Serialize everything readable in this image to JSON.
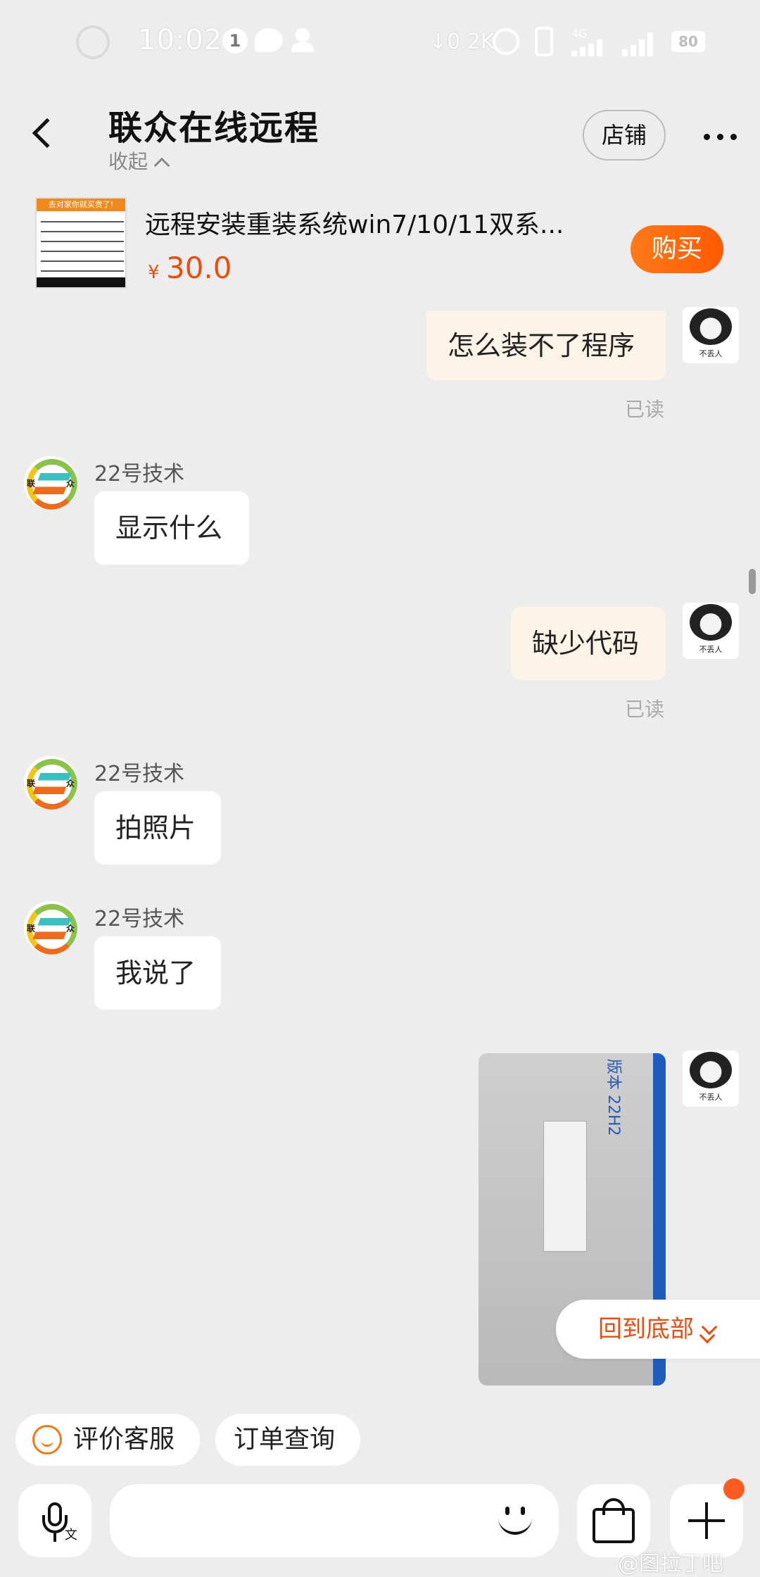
{
  "status_bar": {
    "time": "10:02",
    "notif_count": "1",
    "net_speed": "↓0.2K",
    "network": "4G",
    "battery": "80"
  },
  "header": {
    "title": "联众在线远程",
    "collapse_label": "收起",
    "store_label": "店铺"
  },
  "product": {
    "thumb_banner": "去对家你就买贵了!",
    "name": "远程安装重装系统win7/10/11双系...",
    "currency": "¥",
    "price": "30.0",
    "buy_label": "购买"
  },
  "chat": {
    "my_avatar_caption": "不丢人",
    "messages": [
      {
        "dir": "out",
        "text": "怎么装不了程序",
        "status": "已读"
      },
      {
        "dir": "in",
        "sender": "22号技术",
        "text": "显示什么"
      },
      {
        "dir": "out",
        "text": "缺少代码",
        "status": "已读"
      },
      {
        "dir": "in",
        "sender": "22号技术",
        "text": "拍照片"
      },
      {
        "dir": "in",
        "sender": "22号技术",
        "text": "我说了"
      },
      {
        "dir": "out",
        "type": "image",
        "image_text": "版本 22H2"
      }
    ],
    "shop_avatar_left": "联",
    "shop_avatar_right": "众"
  },
  "back_to_bottom": "回到底部",
  "quick_actions": {
    "rate_service": "评价客服",
    "order_query": "订单查询"
  },
  "watermark": "@图拉丁吧",
  "icons": {
    "back": "chevron-left-icon",
    "more": "more-icon",
    "mic": "voice-input-icon",
    "emoji": "emoji-icon",
    "bag": "shopping-bag-icon",
    "plus": "plus-icon"
  },
  "colors": {
    "accent": "#e94e0f",
    "buy_gradient_start": "#ff7a1a",
    "outgoing_bubble": "#fdf4e8",
    "incoming_bubble": "#ffffff",
    "background": "#ededed"
  }
}
